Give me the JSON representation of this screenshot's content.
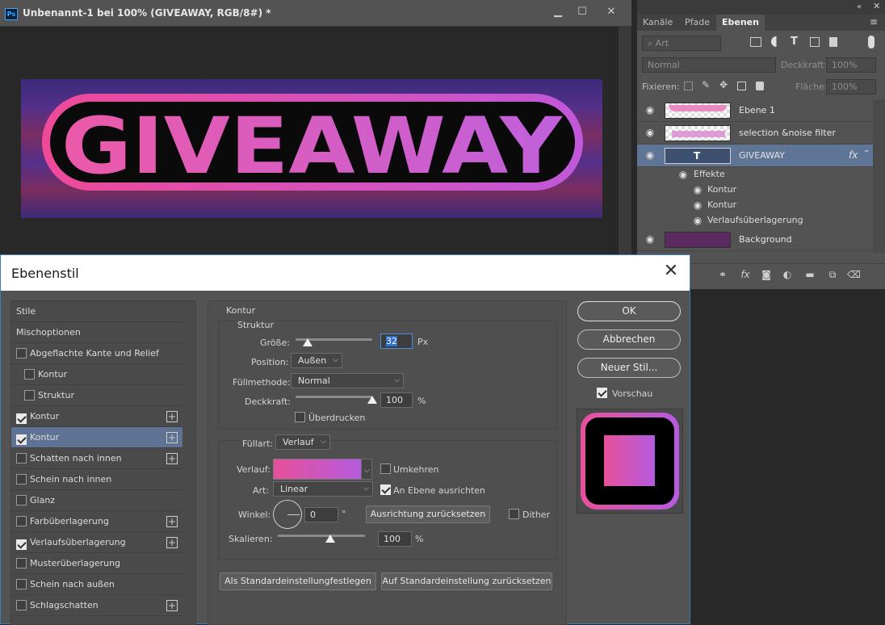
{
  "document": {
    "title": "Unbenannt-1 bei 100% (GIVEAWAY, RGB/8#) *",
    "ps_badge": "Ps",
    "artwork_text": "GIVEAWAY",
    "window_buttons": {
      "minimize": "▁",
      "maximize": "☐",
      "close": "✕"
    }
  },
  "layers_panel": {
    "tabs": [
      "Kanäle",
      "Pfade",
      "Ebenen"
    ],
    "active_tab": "Ebenen",
    "filter_placeholder": "Art",
    "blend_mode": "Normal",
    "opacity_label": "Deckkraft:",
    "opacity_value": "100%",
    "lock_label": "Fixieren:",
    "fill_label": "Fläche:",
    "fill_value": "100%",
    "layers": [
      {
        "name": "Ebene 1"
      },
      {
        "name": "selection &noise filter"
      },
      {
        "name": "GIVEAWAY",
        "fx": "fx",
        "type_icon": "T"
      },
      {
        "name": "Background"
      }
    ],
    "effects_label": "Effekte",
    "effects": [
      "Kontur",
      "Kontur",
      "Verlaufsüberlagerung"
    ]
  },
  "dialog": {
    "title": "Ebenenstil",
    "close": "✕",
    "style_list": [
      {
        "label": "Stile",
        "checkbox": false,
        "plus": false,
        "indent": false,
        "checked": false
      },
      {
        "label": "Mischoptionen",
        "checkbox": false,
        "plus": false,
        "indent": false,
        "checked": false
      },
      {
        "label": "Abgeflachte Kante und Relief",
        "checkbox": true,
        "plus": false,
        "indent": false,
        "checked": false
      },
      {
        "label": "Kontur",
        "checkbox": true,
        "plus": false,
        "indent": true,
        "checked": false
      },
      {
        "label": "Struktur",
        "checkbox": true,
        "plus": false,
        "indent": true,
        "checked": false
      },
      {
        "label": "Kontur",
        "checkbox": true,
        "plus": true,
        "indent": false,
        "checked": true
      },
      {
        "label": "Kontur",
        "checkbox": true,
        "plus": true,
        "indent": false,
        "checked": true,
        "selected": true
      },
      {
        "label": "Schatten nach innen",
        "checkbox": true,
        "plus": true,
        "indent": false,
        "checked": false
      },
      {
        "label": "Schein nach innen",
        "checkbox": true,
        "plus": false,
        "indent": false,
        "checked": false
      },
      {
        "label": "Glanz",
        "checkbox": true,
        "plus": false,
        "indent": false,
        "checked": false
      },
      {
        "label": "Farbüberlagerung",
        "checkbox": true,
        "plus": true,
        "indent": false,
        "checked": false
      },
      {
        "label": "Verlaufsüberlagerung",
        "checkbox": true,
        "plus": true,
        "indent": false,
        "checked": true
      },
      {
        "label": "Musterüberlagerung",
        "checkbox": true,
        "plus": false,
        "indent": false,
        "checked": false
      },
      {
        "label": "Schein nach außen",
        "checkbox": true,
        "plus": false,
        "indent": false,
        "checked": false
      },
      {
        "label": "Schlagschatten",
        "checkbox": true,
        "plus": true,
        "indent": false,
        "checked": false
      }
    ],
    "section_title": "Kontur",
    "structure": {
      "title": "Struktur",
      "size_label": "Größe:",
      "size_value": "32",
      "size_unit": "Px",
      "size_fraction": 0.16,
      "position_label": "Position:",
      "position_value": "Außen",
      "blend_label": "Füllmethode:",
      "blend_value": "Normal",
      "opacity_label": "Deckkraft:",
      "opacity_value": "100",
      "opacity_unit": "%",
      "opacity_fraction": 1.0,
      "overprint_label": "Überdrucken"
    },
    "fill": {
      "type_label": "Füllart:",
      "type_value": "Verlauf",
      "gradient_label": "Verlauf:",
      "reverse_label": "Umkehren",
      "style_label": "Art:",
      "style_value": "Linear",
      "align_label": "An Ebene ausrichten",
      "angle_label": "Winkel:",
      "angle_value": "0",
      "angle_unit": "°",
      "reset_align_label": "Ausrichtung zurücksetzen",
      "dither_label": "Dither",
      "scale_label": "Skalieren:",
      "scale_value": "100",
      "scale_unit": "%",
      "scale_fraction": 0.6,
      "gradient_colors": [
        "#e8509a",
        "#b55be0"
      ]
    },
    "make_default_label": "Als Standardeinstellungfestlegen",
    "reset_default_label": "Auf Standardeinstellung zurücksetzen",
    "ok_label": "OK",
    "cancel_label": "Abbrechen",
    "new_style_label": "Neuer Stil...",
    "preview_label": "Vorschau"
  }
}
